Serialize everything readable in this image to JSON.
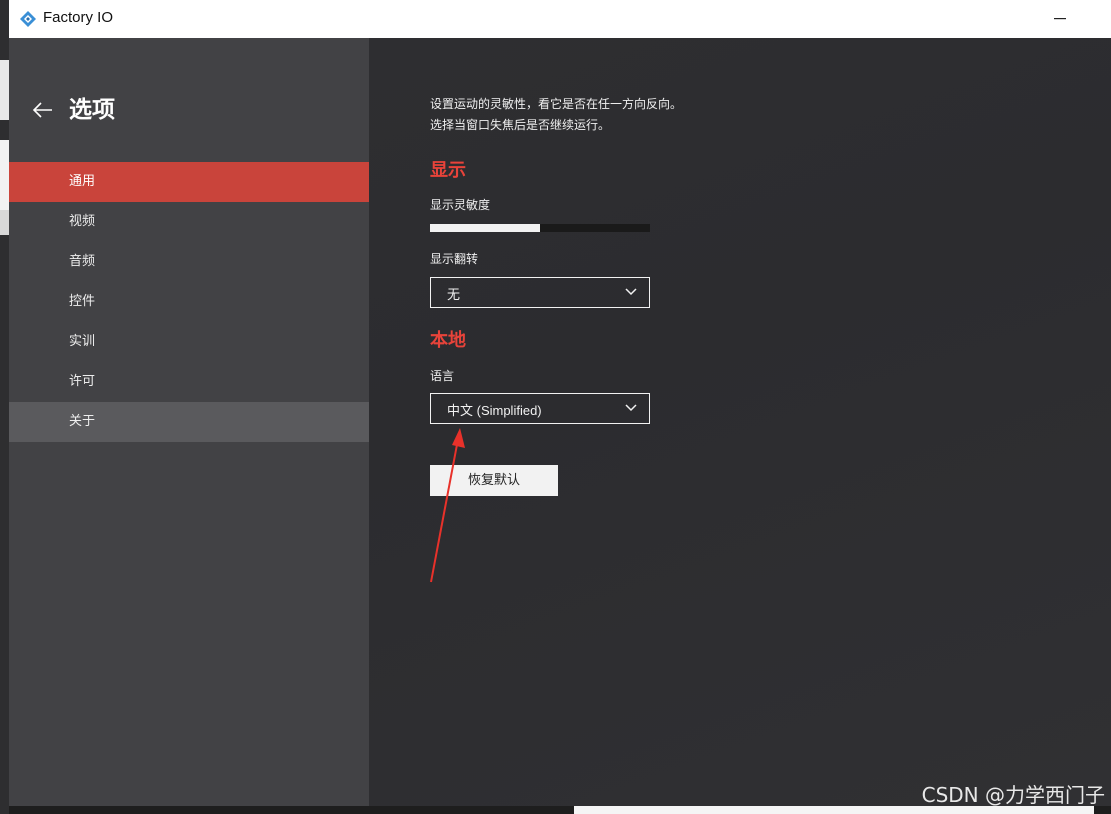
{
  "window": {
    "title": "Factory IO"
  },
  "sidebar": {
    "title": "选项",
    "items": [
      {
        "label": "通用",
        "state": "active"
      },
      {
        "label": "视频",
        "state": "normal"
      },
      {
        "label": "音频",
        "state": "normal"
      },
      {
        "label": "控件",
        "state": "normal"
      },
      {
        "label": "实训",
        "state": "normal"
      },
      {
        "label": "许可",
        "state": "normal"
      },
      {
        "label": "关于",
        "state": "hover"
      }
    ]
  },
  "main": {
    "description": [
      "设置运动的灵敏性，看它是否在任一方向反向。",
      "选择当窗口失焦后是否继续运行。"
    ],
    "display_section": {
      "heading": "显示",
      "sensitivity_label": "显示灵敏度",
      "sensitivity_value": 0.5,
      "invert_label": "显示翻转",
      "invert_value": "无"
    },
    "locale_section": {
      "heading": "本地",
      "language_label": "语言",
      "language_value": "中文 (Simplified)"
    },
    "reset_label": "恢复默认"
  },
  "watermark": "CSDN @力学西门子",
  "colors": {
    "accent": "#c9443b",
    "heading": "#e8433a",
    "annotation_arrow": "#e8312a"
  }
}
